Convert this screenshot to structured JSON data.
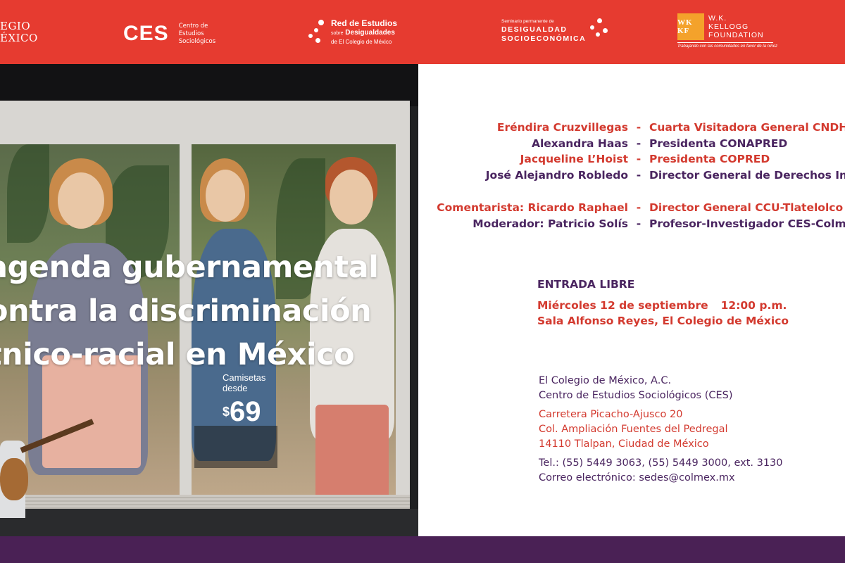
{
  "header": {
    "colmex_line1": "EGIO",
    "colmex_line2": "ÉXICO",
    "ces_mark": "CES",
    "ces_sub": [
      "Centro de",
      "Estudios",
      "Sociológicos"
    ],
    "red_line1": "Red de Estudios",
    "red_line2_small": "sobre",
    "red_line2": "Desigualdades",
    "red_line3": "de El Colegio de México",
    "seminario_line1": "Seminario permanente de",
    "seminario_line2": "DESIGUALDAD",
    "seminario_line3": "SOCIOECONÓMICA",
    "kellogg_box": "WK KF",
    "kellogg_name1": "W.K.",
    "kellogg_name2": "KELLOGG",
    "kellogg_name3": "FOUNDATION",
    "kellogg_tag": "Trabajando con las comunidades en favor de la niñez",
    "bg_color": "#e63b30"
  },
  "photo": {
    "title": "agenda gubernamental\nontra la discriminación\ntnico-racial en México",
    "price_line1": "Camisetas",
    "price_line2": "desde",
    "price_symbol": "$",
    "price_value": "69"
  },
  "speakers": [
    {
      "name": "Eréndira Cruzvillegas",
      "role": "Cuarta Visitadora General CNDH",
      "color": "red"
    },
    {
      "name": "Alexandra Haas",
      "role": "Presidenta CONAPRED",
      "color": "purple"
    },
    {
      "name": "Jacqueline L’Hoist",
      "role": "Presidenta COPRED",
      "color": "red"
    },
    {
      "name": "José Alejandro Robledo",
      "role": "Director General de Derechos Ind",
      "color": "purple"
    }
  ],
  "panel_extra": [
    {
      "name": "Comentarista: Ricardo Raphael",
      "role": "Director General CCU-Tlatelolco",
      "color": "red"
    },
    {
      "name": "Moderador: Patricio Solís",
      "role": "Profesor-Investigador CES-Colm",
      "color": "purple"
    }
  ],
  "separator": "-",
  "event": {
    "entrada": "ENTRADA LIBRE",
    "date": "Miércoles 12 de septiembre",
    "time": "12:00 p.m.",
    "place": "Sala Alfonso Reyes, El Colegio de México"
  },
  "address": {
    "institution": "El Colegio de México, A.C.",
    "center": "Centro de Estudios Sociológicos (CES)",
    "street": "Carretera Picacho-Ajusco 20",
    "colonia": "Col. Ampliación Fuentes del Pedregal",
    "city": "14110 Tlalpan, Ciudad de México",
    "phone": "Tel.: (55) 5449 3063, (55) 5449 3000, ext. 3130",
    "email": "Correo electrónico: sedes@colmex.mx"
  },
  "colors": {
    "red": "#d33a2f",
    "purple": "#4a2560",
    "footer": "#4a2155"
  }
}
